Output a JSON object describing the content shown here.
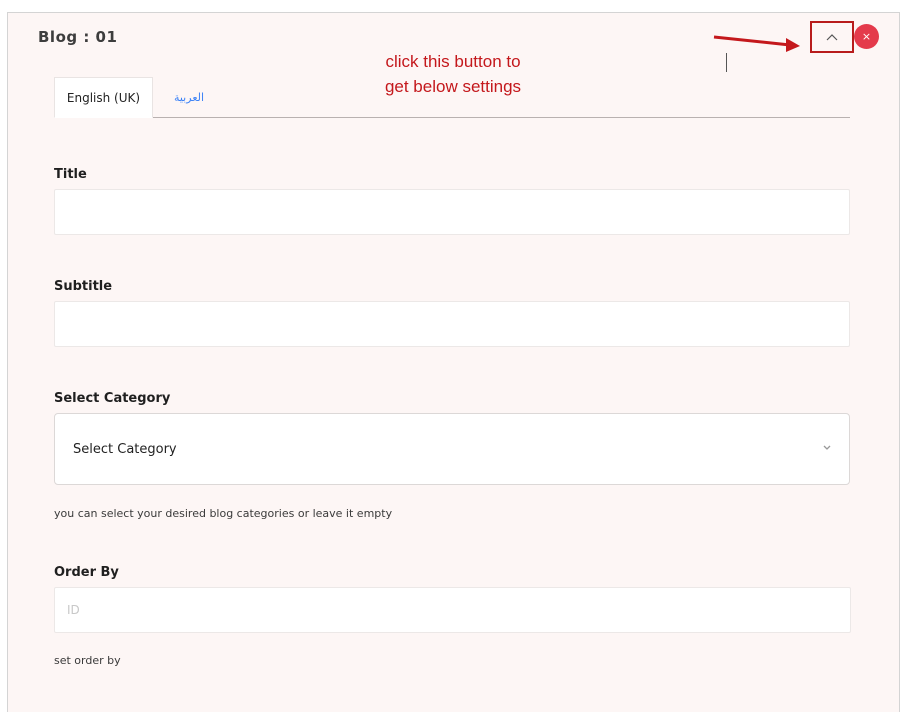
{
  "panel": {
    "title": "Blog : 01",
    "close_symbol": "×"
  },
  "annotation": {
    "line1": "click this button to",
    "line2": "get below settings",
    "color": "#c4181c"
  },
  "tabs": [
    {
      "label": "English (UK)",
      "active": true
    },
    {
      "label": "العربية",
      "active": false
    }
  ],
  "fields": {
    "title": {
      "label": "Title",
      "value": ""
    },
    "subtitle": {
      "label": "Subtitle",
      "value": ""
    },
    "category": {
      "label": "Select Category",
      "selected": "Select Category",
      "help": "you can select your desired blog categories or leave it empty"
    },
    "order_by": {
      "label": "Order By",
      "placeholder": "ID",
      "help": "set order by"
    }
  },
  "icons": {
    "collapse": "chevron-up-icon",
    "close": "close-icon",
    "select_caret": "chevron-down-icon"
  },
  "colors": {
    "panel_bg": "#fdf6f5",
    "close_button": "#e43a4b",
    "tab_link": "#3b82f6",
    "highlight_border": "#b81c1c"
  }
}
